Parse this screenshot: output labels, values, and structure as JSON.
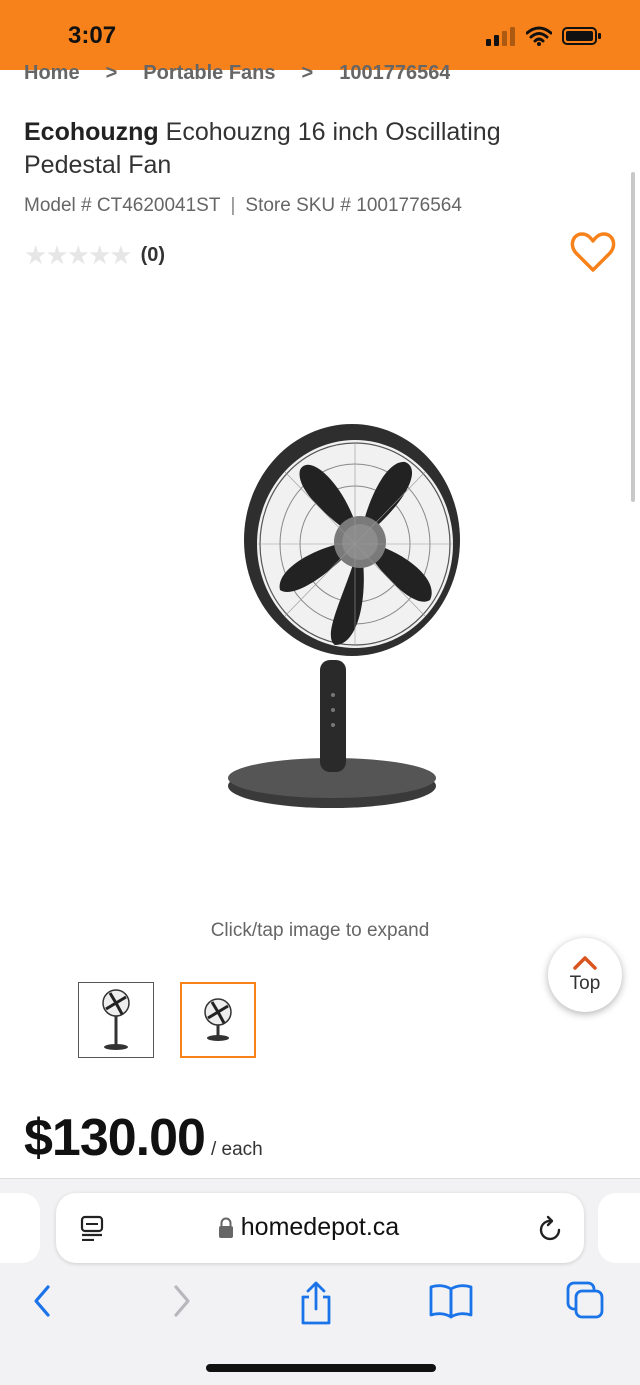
{
  "status": {
    "time": "3:07"
  },
  "breadcrumb": {
    "items": [
      "Home",
      "Portable Fans",
      "1001776564"
    ],
    "separator": ">"
  },
  "product": {
    "brand": "Ecohouzng",
    "name": "Ecohouzng 16 inch Oscillating Pedestal Fan",
    "model": "Model # CT4620041ST",
    "sku": "Store SKU # 1001776564",
    "model_sep": "|",
    "review_count": "(0)",
    "rating": 0,
    "expand_hint": "Click/tap image to expand",
    "price": "$130.00",
    "price_unit": "/ each"
  },
  "top_button": {
    "label": "Top"
  },
  "browser": {
    "url": "homedepot.ca"
  },
  "colors": {
    "accent": "#f7821b",
    "link_blue": "#1a73e8"
  },
  "icons": [
    "wifi-icon",
    "battery-icon",
    "heart-icon",
    "chevron-up-icon",
    "reader-icon",
    "lock-icon",
    "reload-icon",
    "back-icon",
    "forward-icon",
    "share-icon",
    "bookmarks-icon",
    "tabs-icon"
  ]
}
